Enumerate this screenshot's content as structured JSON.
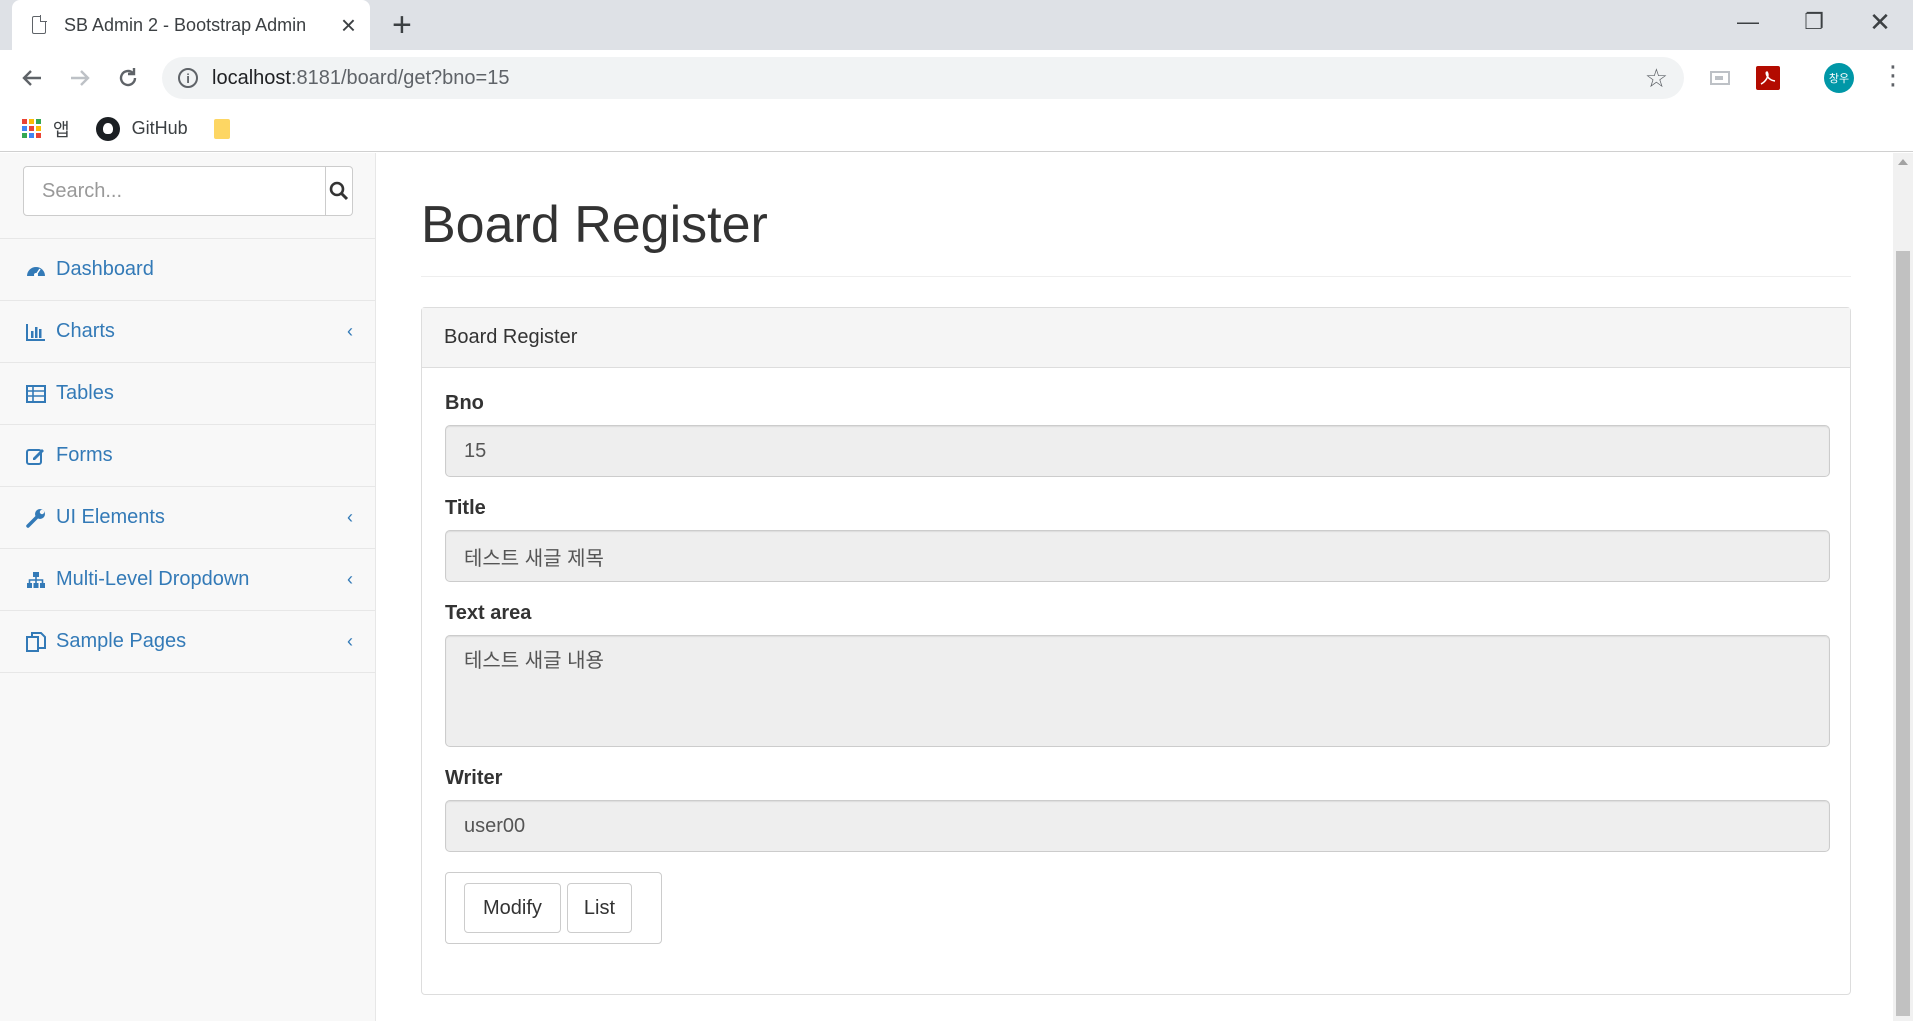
{
  "browser": {
    "tab_title": "SB Admin 2 - Bootstrap Admin",
    "url_host": "localhost",
    "url_path": ":8181/board/get?bno=15",
    "avatar_text": "창우",
    "bookmarks": {
      "apps_label": "앱",
      "github_label": "GitHub"
    }
  },
  "sidebar": {
    "search_placeholder": "Search...",
    "items": [
      {
        "label": "Dashboard",
        "icon": "dashboard-icon",
        "has_chevron": false
      },
      {
        "label": "Charts",
        "icon": "bar-chart-icon",
        "has_chevron": true
      },
      {
        "label": "Tables",
        "icon": "table-icon",
        "has_chevron": false
      },
      {
        "label": "Forms",
        "icon": "edit-icon",
        "has_chevron": false
      },
      {
        "label": "UI Elements",
        "icon": "wrench-icon",
        "has_chevron": true
      },
      {
        "label": "Multi-Level Dropdown",
        "icon": "sitemap-icon",
        "has_chevron": true
      },
      {
        "label": "Sample Pages",
        "icon": "files-icon",
        "has_chevron": true
      }
    ]
  },
  "main": {
    "page_title": "Board Register",
    "panel_heading": "Board Register",
    "fields": {
      "bno": {
        "label": "Bno",
        "value": "15"
      },
      "title": {
        "label": "Title",
        "value": "테스트 새글 제목"
      },
      "content": {
        "label": "Text area",
        "value": "테스트 새글 내용"
      },
      "writer": {
        "label": "Writer",
        "value": "user00"
      }
    },
    "buttons": {
      "modify": "Modify",
      "list": "List"
    }
  },
  "colors": {
    "link": "#337ab7",
    "avatar": "#0097a7",
    "readonly_bg": "#eeeeee"
  }
}
